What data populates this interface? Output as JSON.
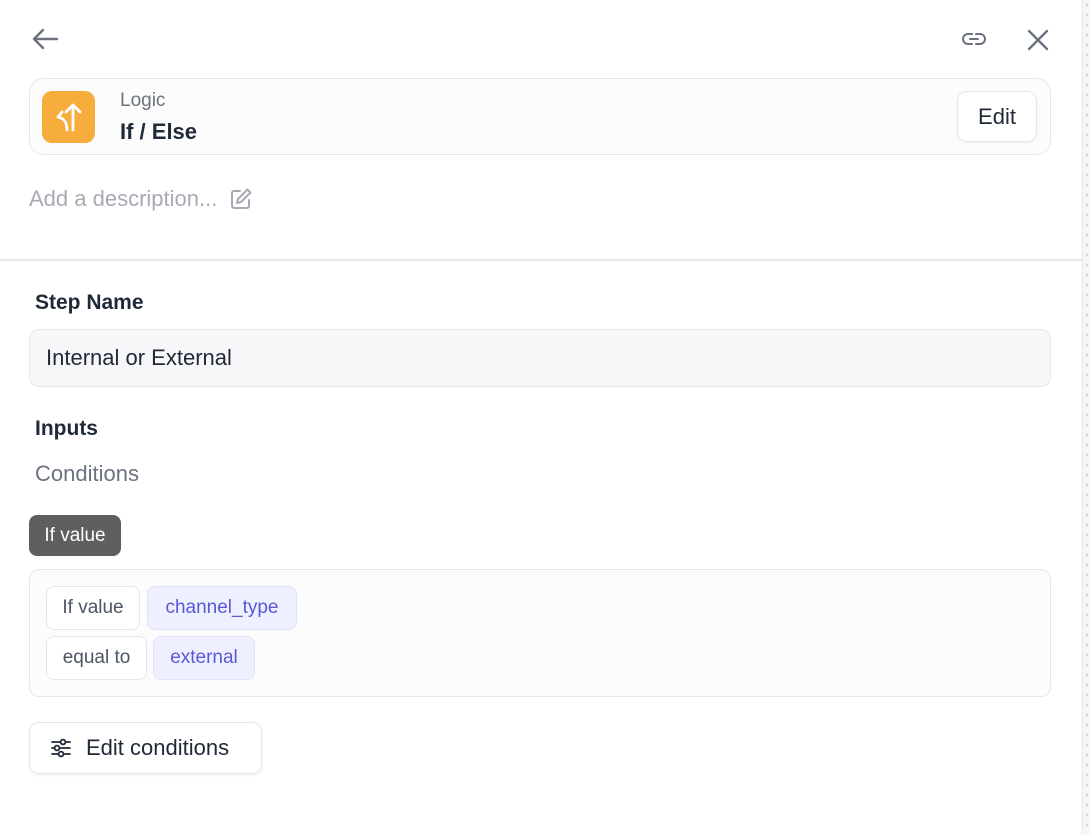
{
  "header": {
    "back_icon": "arrow-left-icon",
    "link_icon": "link-icon",
    "close_icon": "close-icon"
  },
  "step": {
    "icon": "split-arrow-icon",
    "icon_color": "#f6ad3c",
    "category": "Logic",
    "type": "If / Else",
    "edit_label": "Edit"
  },
  "description": {
    "placeholder": "Add a description...",
    "icon": "edit-icon"
  },
  "form": {
    "step_name_label": "Step Name",
    "step_name_value": "Internal or External",
    "inputs_label": "Inputs",
    "conditions_label": "Conditions"
  },
  "conditions": {
    "tag": "If value",
    "rows": [
      {
        "operator": "If value",
        "value": "channel_type"
      },
      {
        "operator": "equal to",
        "value": "external"
      }
    ],
    "accent_color": "#5a58d6",
    "edit_button_label": "Edit conditions",
    "edit_button_icon": "sliders-icon"
  }
}
